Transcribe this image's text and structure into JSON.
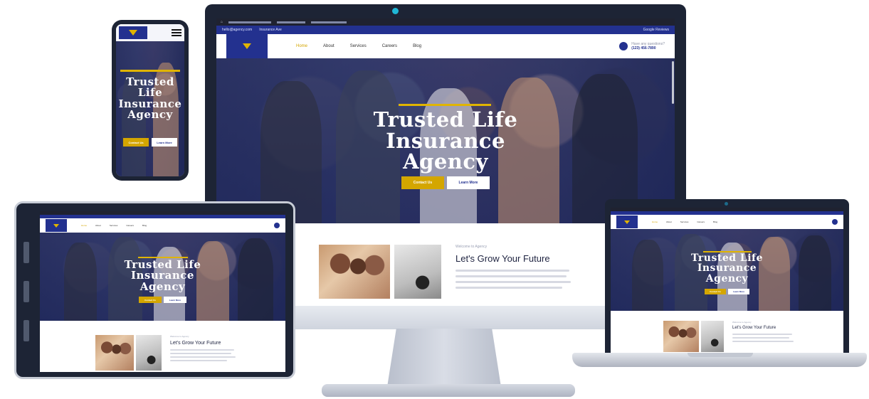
{
  "hero": {
    "title_line1": "Trusted Life",
    "title_line2": "Insurance",
    "title_line3": "Agency",
    "primary_btn": "Contact Us",
    "secondary_btn": "Learn More"
  },
  "nav": {
    "items": [
      "Home",
      "About",
      "Services",
      "Careers",
      "Blog"
    ],
    "phone_label": "Have any questions?",
    "phone_number": "(123) 456-7890"
  },
  "topbar": {
    "email": "hello@agency.com",
    "address": "Insurance Ave",
    "right": "Google Reviews"
  },
  "about": {
    "kicker": "Welcome to Agency",
    "title": "Let's Grow Your Future"
  },
  "colors": {
    "brand_blue": "#23318f",
    "accent_gold": "#d4a600",
    "frame_dark": "#1d2435"
  }
}
